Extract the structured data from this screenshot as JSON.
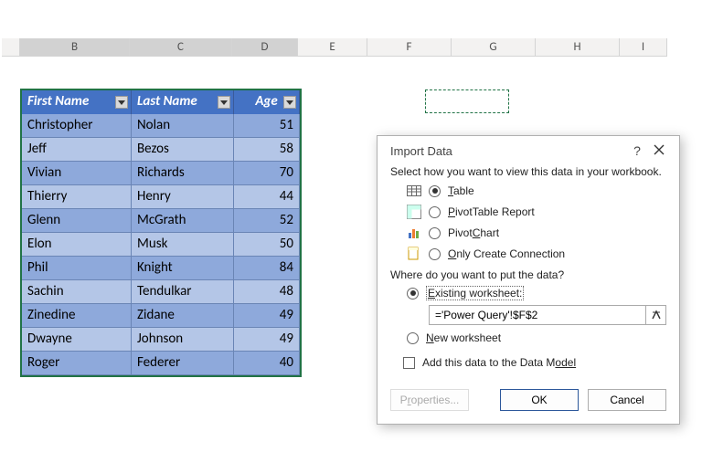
{
  "columns": [
    "B",
    "C",
    "D",
    "E",
    "F",
    "G",
    "H",
    "I"
  ],
  "headers": {
    "first": "First Name",
    "last": "Last Name",
    "age": "Age"
  },
  "rows": [
    {
      "first": "Christopher",
      "last": "Nolan",
      "age": "51"
    },
    {
      "first": "Jeff",
      "last": "Bezos",
      "age": "58"
    },
    {
      "first": "Vivian",
      "last": "Richards",
      "age": "70"
    },
    {
      "first": "Thierry",
      "last": "Henry",
      "age": "44"
    },
    {
      "first": "Glenn",
      "last": "McGrath",
      "age": "52"
    },
    {
      "first": "Elon",
      "last": "Musk",
      "age": "50"
    },
    {
      "first": "Phil",
      "last": "Knight",
      "age": "84"
    },
    {
      "first": "Sachin",
      "last": "Tendulkar",
      "age": "48"
    },
    {
      "first": "Zinedine",
      "last": "Zidane",
      "age": "49"
    },
    {
      "first": "Dwayne",
      "last": "Johnson",
      "age": "49"
    },
    {
      "first": "Roger",
      "last": "Federer",
      "age": "40"
    }
  ],
  "dialog": {
    "title": "Import Data",
    "prompt": "Select how you want to view this data in your workbook.",
    "opt_table": "able",
    "opt_pivottable": "ivotTable Report",
    "opt_pivotchart": "PivotChart",
    "opt_connection": "nly Create Connection",
    "where": "Where do you want to put the data?",
    "existing": "xisting worksheet:",
    "ref_value": "='Power Query'!$F$2",
    "newws": "ew worksheet",
    "datamodel": "Add this data to the Data M",
    "datamodel2": "odel",
    "properties": "roperties...",
    "ok": "OK",
    "cancel": "Cancel"
  }
}
